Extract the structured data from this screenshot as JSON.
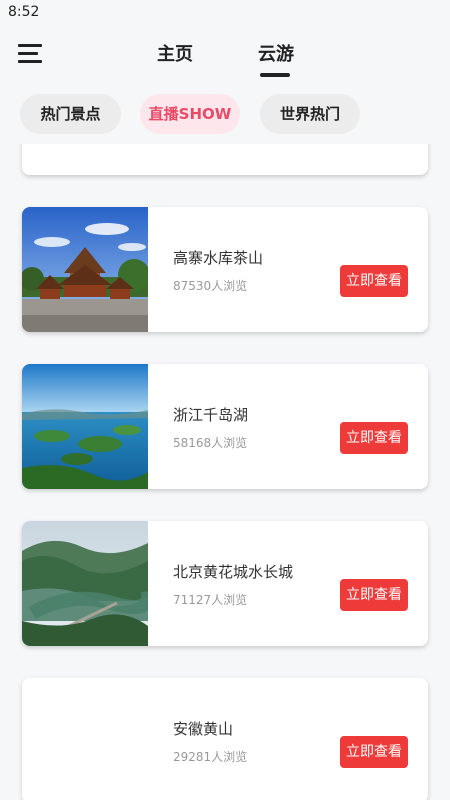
{
  "status_bar": {
    "time": "8:52"
  },
  "header": {
    "tabs": [
      {
        "label": "主页"
      },
      {
        "label": "云游"
      }
    ]
  },
  "categories": [
    {
      "label": "热门景点"
    },
    {
      "label": "直播SHOW"
    },
    {
      "label": "世界热门"
    }
  ],
  "spots": [
    {
      "name": "",
      "views": "",
      "button": ""
    },
    {
      "name": "高寨水库茶山",
      "views": "87530人浏览",
      "button": "立即查看"
    },
    {
      "name": "浙江千岛湖",
      "views": "58168人浏览",
      "button": "立即查看"
    },
    {
      "name": "北京黄花城水长城",
      "views": "71127人浏览",
      "button": "立即查看"
    },
    {
      "name": "安徽黄山",
      "views": "29281人浏览",
      "button": "立即查看"
    }
  ],
  "colors": {
    "accent": "#ef3a3a",
    "active_chip_bg": "#fde7ec",
    "active_chip_text": "#e94b67"
  }
}
